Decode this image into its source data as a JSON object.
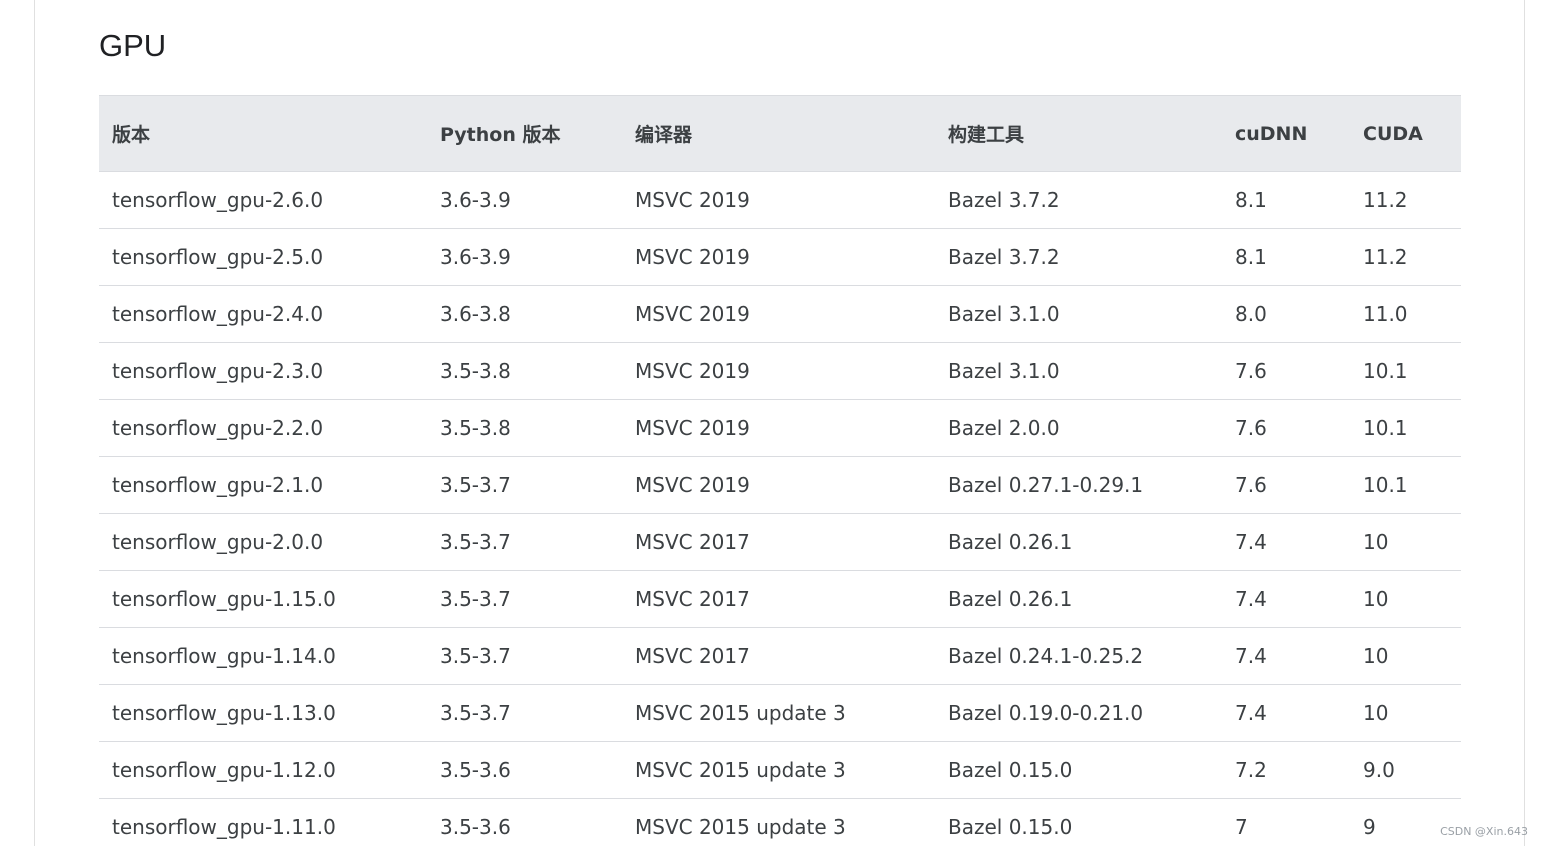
{
  "heading": "GPU",
  "table": {
    "headers": [
      "版本",
      "Python 版本",
      "编译器",
      "构建工具",
      "cuDNN",
      "CUDA"
    ],
    "rows": [
      [
        "tensorflow_gpu-2.6.0",
        "3.6-3.9",
        "MSVC 2019",
        "Bazel 3.7.2",
        "8.1",
        "11.2"
      ],
      [
        "tensorflow_gpu-2.5.0",
        "3.6-3.9",
        "MSVC 2019",
        "Bazel 3.7.2",
        "8.1",
        "11.2"
      ],
      [
        "tensorflow_gpu-2.4.0",
        "3.6-3.8",
        "MSVC 2019",
        "Bazel 3.1.0",
        "8.0",
        "11.0"
      ],
      [
        "tensorflow_gpu-2.3.0",
        "3.5-3.8",
        "MSVC 2019",
        "Bazel 3.1.0",
        "7.6",
        "10.1"
      ],
      [
        "tensorflow_gpu-2.2.0",
        "3.5-3.8",
        "MSVC 2019",
        "Bazel 2.0.0",
        "7.6",
        "10.1"
      ],
      [
        "tensorflow_gpu-2.1.0",
        "3.5-3.7",
        "MSVC 2019",
        "Bazel 0.27.1-0.29.1",
        "7.6",
        "10.1"
      ],
      [
        "tensorflow_gpu-2.0.0",
        "3.5-3.7",
        "MSVC 2017",
        "Bazel 0.26.1",
        "7.4",
        "10"
      ],
      [
        "tensorflow_gpu-1.15.0",
        "3.5-3.7",
        "MSVC 2017",
        "Bazel 0.26.1",
        "7.4",
        "10"
      ],
      [
        "tensorflow_gpu-1.14.0",
        "3.5-3.7",
        "MSVC 2017",
        "Bazel 0.24.1-0.25.2",
        "7.4",
        "10"
      ],
      [
        "tensorflow_gpu-1.13.0",
        "3.5-3.7",
        "MSVC 2015 update 3",
        "Bazel 0.19.0-0.21.0",
        "7.4",
        "10"
      ],
      [
        "tensorflow_gpu-1.12.0",
        "3.5-3.6",
        "MSVC 2015 update 3",
        "Bazel 0.15.0",
        "7.2",
        "9.0"
      ],
      [
        "tensorflow_gpu-1.11.0",
        "3.5-3.6",
        "MSVC 2015 update 3",
        "Bazel 0.15.0",
        "7",
        "9"
      ]
    ]
  },
  "watermark": "CSDN @Xin.643",
  "colors": {
    "header_bg": "#e8eaed",
    "text": "#3c4043",
    "border": "#dadce0"
  }
}
